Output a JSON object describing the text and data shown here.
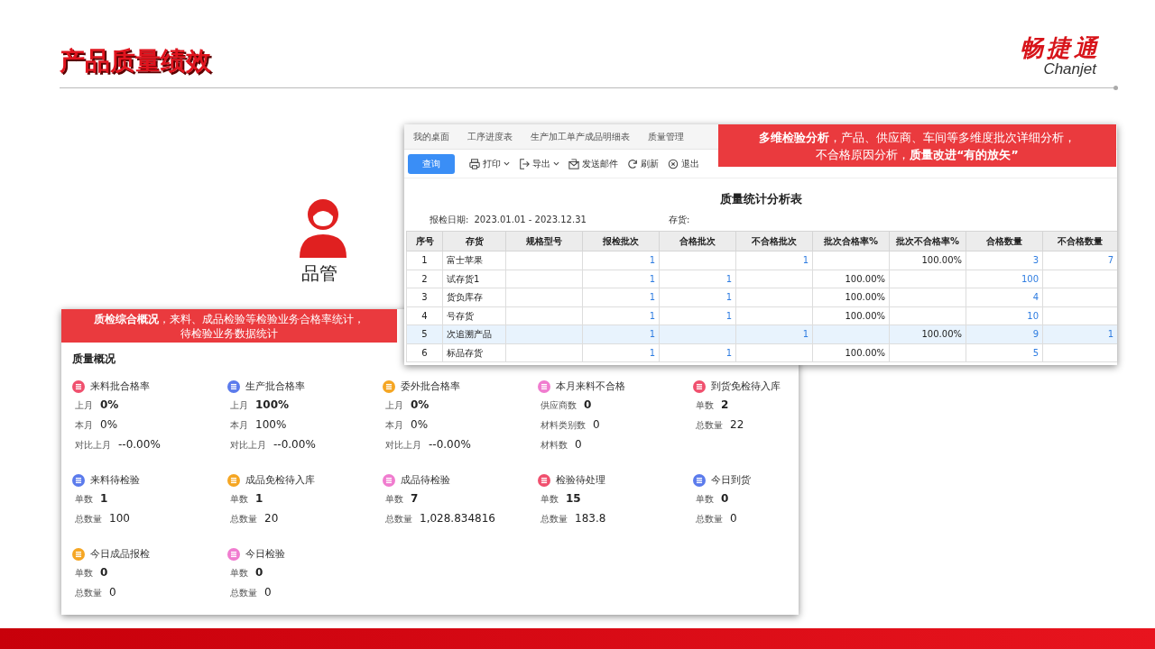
{
  "slide": {
    "title": "产品质量绩效",
    "logo_cn": "畅捷通",
    "logo_en": "Chanjet",
    "role_label": "品管"
  },
  "report_window": {
    "tabs": [
      "我的桌面",
      "工序进度表",
      "生产加工单产成品明细表",
      "质量管理"
    ],
    "toolbar": [
      {
        "label": "查询",
        "kind": "primary",
        "dropdown": false
      },
      {
        "label": "打印",
        "kind": "tool",
        "dropdown": true
      },
      {
        "label": "导出",
        "kind": "tool",
        "dropdown": true
      },
      {
        "label": "发送邮件",
        "kind": "tool",
        "dropdown": false
      },
      {
        "label": "刷新",
        "kind": "tool",
        "dropdown": false
      },
      {
        "label": "退出",
        "kind": "tool",
        "dropdown": false
      }
    ],
    "report_title": "质量统计分析表",
    "filters": [
      {
        "label": "报检日期:",
        "value": "2023.01.01 - 2023.12.31"
      },
      {
        "label": "存货:"
      }
    ],
    "table": {
      "columns": [
        "序号",
        "存货",
        "规格型号",
        "报检批次",
        "合格批次",
        "不合格批次",
        "批次合格率%",
        "批次不合格率%",
        "合格数量",
        "不合格数量"
      ],
      "rows": [
        {
          "selected": false,
          "cells": [
            "1",
            "富士苹果",
            "",
            "1",
            "",
            "1",
            "",
            "100.00%",
            "3",
            "7"
          ]
        },
        {
          "selected": false,
          "cells": [
            "2",
            "试存货1",
            "",
            "1",
            "1",
            "",
            "100.00%",
            "",
            "100",
            ""
          ]
        },
        {
          "selected": false,
          "cells": [
            "3",
            "货负库存",
            "",
            "1",
            "1",
            "",
            "100.00%",
            "",
            "4",
            ""
          ]
        },
        {
          "selected": false,
          "cells": [
            "4",
            "号存货",
            "",
            "1",
            "1",
            "",
            "100.00%",
            "",
            "10",
            ""
          ]
        },
        {
          "selected": true,
          "cells": [
            "5",
            "次追溯产品",
            "",
            "1",
            "",
            "1",
            "",
            "100.00%",
            "9",
            "1"
          ]
        },
        {
          "selected": false,
          "cells": [
            "6",
            "标品存货",
            "",
            "1",
            "1",
            "",
            "100.00%",
            "",
            "5",
            ""
          ]
        }
      ]
    },
    "callout": [
      "**多维检验分析**，产品、供应商、车间等多维度批次详细分析，",
      "不合格原因分析，**质量改进“有的放矢”**"
    ]
  },
  "dashboard": {
    "callout": [
      "**质检综合概况**，来料、成品检验等检验业务合格率统计，",
      "待检验业务数据统计"
    ],
    "title": "质量概况",
    "cards": [
      {
        "title": "来料批合格率",
        "color": "#f0506e",
        "lines": [
          {
            "label": "上月",
            "value": "0%",
            "strong": true
          },
          {
            "label": "本月",
            "value": "0%",
            "strong": false
          },
          {
            "label": "对比上月",
            "value": "--0.00%",
            "strong": false
          }
        ]
      },
      {
        "title": "生产批合格率",
        "color": "#5b7bec",
        "lines": [
          {
            "label": "上月",
            "value": "100%",
            "strong": true
          },
          {
            "label": "本月",
            "value": "100%",
            "strong": false
          },
          {
            "label": "对比上月",
            "value": "--0.00%",
            "strong": false
          }
        ]
      },
      {
        "title": "委外批合格率",
        "color": "#f5a623",
        "lines": [
          {
            "label": "上月",
            "value": "0%",
            "strong": true
          },
          {
            "label": "本月",
            "value": "0%",
            "strong": false
          },
          {
            "label": "对比上月",
            "value": "--0.00%",
            "strong": false
          }
        ]
      },
      {
        "title": "本月来料不合格",
        "color": "#f07ccf",
        "lines": [
          {
            "label": "供应商数",
            "value": "0",
            "strong": true
          },
          {
            "label": "材料类别数",
            "value": "0",
            "strong": false
          },
          {
            "label": "材料数",
            "value": "0",
            "strong": false
          }
        ]
      },
      {
        "title": "到货免检待入库",
        "color": "#f0506e",
        "lines": [
          {
            "label": "单数",
            "value": "2",
            "strong": true
          },
          {
            "label": "总数量",
            "value": "22",
            "strong": false
          }
        ]
      },
      {
        "title": "来料待检验",
        "color": "#5b7bec",
        "lines": [
          {
            "label": "单数",
            "value": "1",
            "strong": true
          },
          {
            "label": "总数量",
            "value": "100",
            "strong": false
          }
        ]
      },
      {
        "title": "成品免检待入库",
        "color": "#f5a623",
        "lines": [
          {
            "label": "单数",
            "value": "1",
            "strong": true
          },
          {
            "label": "总数量",
            "value": "20",
            "strong": false
          }
        ]
      },
      {
        "title": "成品待检验",
        "color": "#f07ccf",
        "lines": [
          {
            "label": "单数",
            "value": "7",
            "strong": true
          },
          {
            "label": "总数量",
            "value": "1,028.834816",
            "strong": false
          }
        ]
      },
      {
        "title": "检验待处理",
        "color": "#f0506e",
        "lines": [
          {
            "label": "单数",
            "value": "15",
            "strong": true
          },
          {
            "label": "总数量",
            "value": "183.8",
            "strong": false
          }
        ]
      },
      {
        "title": "今日到货",
        "color": "#5b7bec",
        "lines": [
          {
            "label": "单数",
            "value": "0",
            "strong": true
          },
          {
            "label": "总数量",
            "value": "0",
            "strong": false
          }
        ]
      },
      {
        "title": "今日成品报检",
        "color": "#f5a623",
        "lines": [
          {
            "label": "单数",
            "value": "0",
            "strong": true
          },
          {
            "label": "总数量",
            "value": "0",
            "strong": false
          }
        ]
      },
      {
        "title": "今日检验",
        "color": "#f07ccf",
        "lines": [
          {
            "label": "单数",
            "value": "0",
            "strong": true
          },
          {
            "label": "总数量",
            "value": "0",
            "strong": false
          }
        ]
      }
    ]
  }
}
